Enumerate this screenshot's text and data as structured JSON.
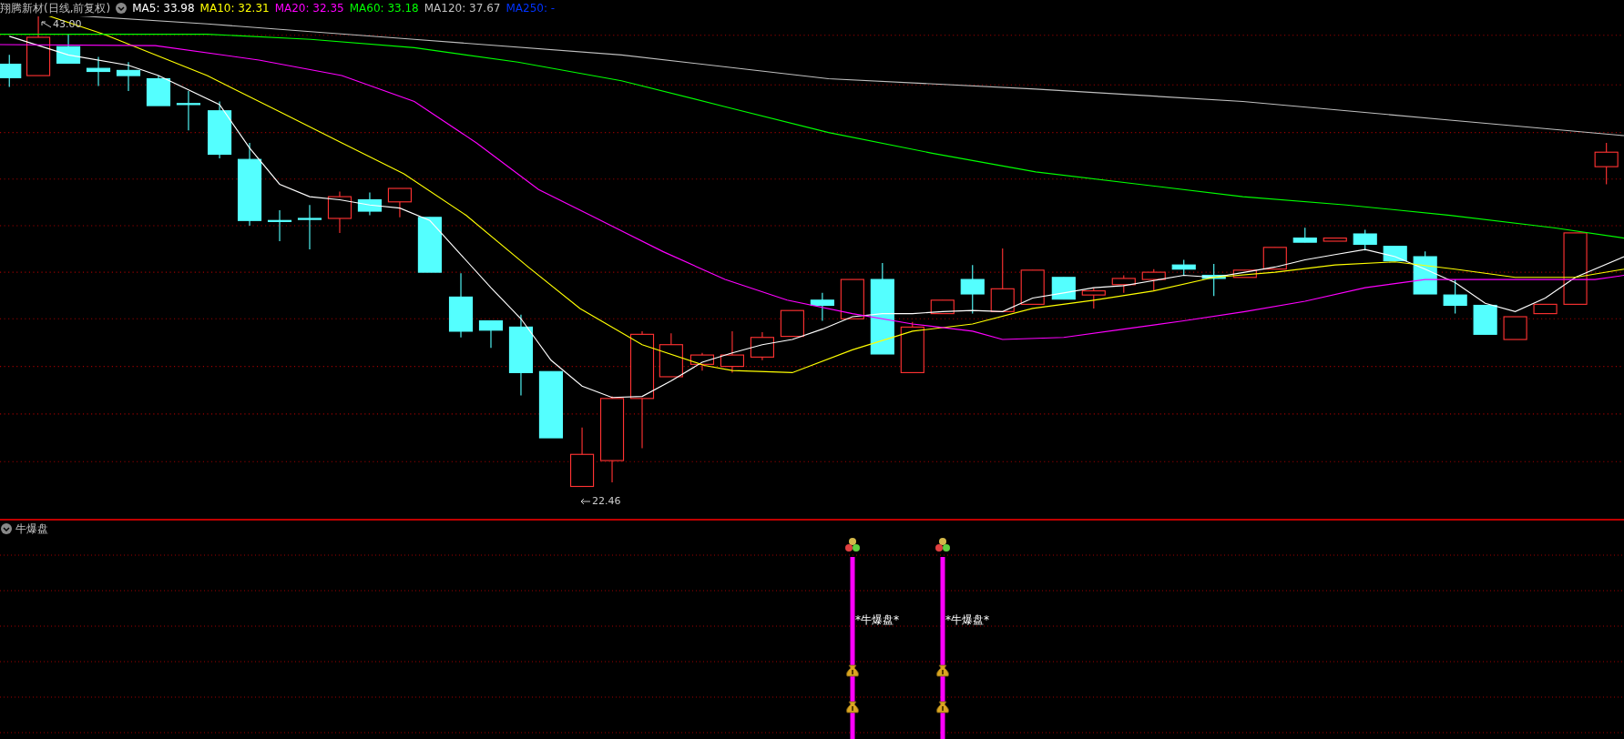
{
  "chart_header": {
    "title": "翔腾新材(日线,前复权)",
    "indicators": [
      {
        "label": "MA5: 33.98",
        "color": "#ffffff"
      },
      {
        "label": "MA10: 32.31",
        "color": "#ffff00"
      },
      {
        "label": "MA20: 32.35",
        "color": "#ff00ff"
      },
      {
        "label": "MA60: 33.18",
        "color": "#00ff00"
      },
      {
        "label": "MA120: 37.67",
        "color": "#c0c0c0"
      },
      {
        "label": "MA250: -",
        "color": "#0033ff"
      }
    ]
  },
  "price_marks": {
    "high": "43.00",
    "low": "22.46"
  },
  "indicator_panel": {
    "title": "牛爆盘",
    "signals": [
      {
        "label": "*牛爆盘*"
      },
      {
        "label": "*牛爆盘*"
      }
    ]
  }
}
